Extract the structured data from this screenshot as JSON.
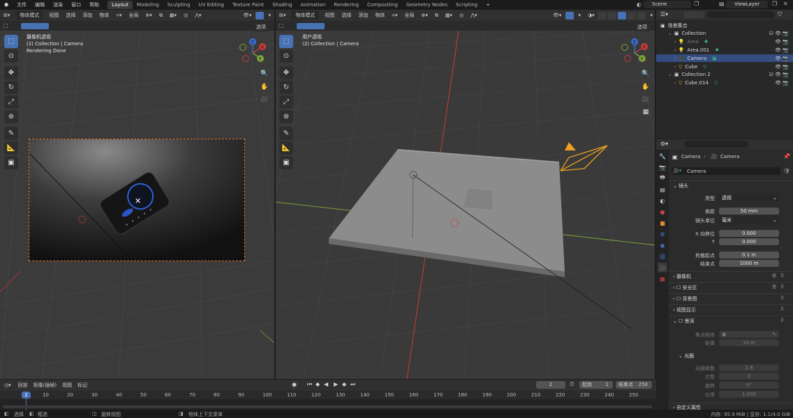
{
  "menu": {
    "items": [
      "文件",
      "编辑",
      "渲染",
      "窗口",
      "帮助"
    ],
    "workspaces": [
      "Layout",
      "Modeling",
      "Sculpting",
      "UV Editing",
      "Texture Paint",
      "Shading",
      "Animation",
      "Rendering",
      "Compositing",
      "Geometry Nodes",
      "Scripting"
    ],
    "active_workspace": "Layout",
    "add_tab": "+",
    "scene": "Scene",
    "view_layer": "ViewLayer"
  },
  "left_viewport": {
    "mode": "物体模式",
    "menus": [
      "视图",
      "选择",
      "添加",
      "物体"
    ],
    "orientation": "全局",
    "options": "选项",
    "info_title": "摄像机透视",
    "info_collection": "(2) Collection | Camera",
    "info_status": "Rendering Done"
  },
  "right_viewport": {
    "mode": "物体模式",
    "menus": [
      "视图",
      "选择",
      "添加",
      "物体"
    ],
    "orientation": "全局",
    "options": "选项",
    "info_title": "用户透视",
    "info_collection": "(2) Collection | Camera"
  },
  "gizmo": {
    "x": "X",
    "y": "Y",
    "z": "Z"
  },
  "outliner": {
    "root": "场景集合",
    "rows": [
      {
        "name": "Collection",
        "indent": 1,
        "type": "collection"
      },
      {
        "name": "Area",
        "indent": 2,
        "type": "light",
        "dim": true
      },
      {
        "name": "Area.001",
        "indent": 2,
        "type": "light"
      },
      {
        "name": "Camera",
        "indent": 2,
        "type": "camera",
        "selected": true
      },
      {
        "name": "Cube",
        "indent": 2,
        "type": "mesh"
      },
      {
        "name": "Collection 2",
        "indent": 1,
        "type": "collection"
      },
      {
        "name": "Cube.014",
        "indent": 2,
        "type": "mesh"
      }
    ]
  },
  "properties": {
    "breadcrumb_object": "Camera",
    "breadcrumb_data": "Camera",
    "data_name": "Camera",
    "lens_panel": "镜头",
    "type_label": "类型",
    "type_value": "透视",
    "focal_label": "焦距",
    "focal_value": "50 mm",
    "lens_unit_label": "镜头单位",
    "lens_unit_value": "毫米",
    "shift_x_label": "X 向移位",
    "shift_x_value": "0.000",
    "shift_y_label": "Y",
    "shift_y_value": "0.000",
    "clip_start_label": "剪裁起点",
    "clip_start_value": "0.1 m",
    "clip_end_label": "结束点",
    "clip_end_value": "1000 m",
    "panels": [
      "摄像机",
      "安全区",
      "背景图",
      "视图显示"
    ],
    "dof_panel": "景深",
    "focus_object_label": "焦点物体",
    "distance_label": "距离",
    "distance_value": "10 m",
    "aperture_panel": "光圈",
    "fstop_label": "光圈级数",
    "fstop_value": "2.8",
    "blades_label": "刃型",
    "blades_value": "0",
    "rotation_label": "旋转",
    "rotation_value": "0°",
    "ratio_label": "比率",
    "ratio_value": "1.000",
    "custom_props": "自定义属性"
  },
  "timeline": {
    "menus": [
      "回放",
      "抠像(插帧)",
      "视图",
      "标记"
    ],
    "current_frame": "2",
    "start_label": "起始",
    "start_value": "1",
    "end_label": "结束点",
    "end_value": "250",
    "ticks": [
      "10",
      "20",
      "30",
      "40",
      "50",
      "60",
      "70",
      "80",
      "90",
      "100",
      "110",
      "120",
      "130",
      "140",
      "150",
      "160",
      "170",
      "180",
      "190",
      "200",
      "210",
      "220",
      "230",
      "240",
      "250"
    ],
    "playhead": "2"
  },
  "status": {
    "select": "选择",
    "box_select": "框选",
    "rotate_view": "旋转视图",
    "context_menu": "物体上下文菜单",
    "memory": "内存: 95.9 MiB | 显存: 1.1/4.0 GiB"
  },
  "colors": {
    "accent": "#4772b3",
    "camera_orange": "#f0a020",
    "x_axis": "#c83c3c",
    "y_axis": "#7ca23a"
  }
}
